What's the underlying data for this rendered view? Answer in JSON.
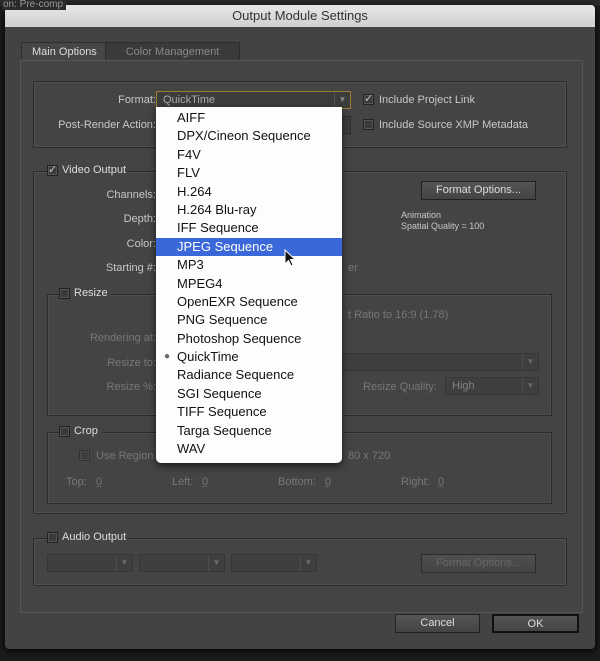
{
  "background": {
    "text": "on: Pre-comp"
  },
  "window": {
    "title": "Output Module Settings"
  },
  "tabs": [
    {
      "label": "Main Options",
      "active": true
    },
    {
      "label": "Color Management",
      "active": false
    }
  ],
  "format": {
    "label": "Format:",
    "value": "QuickTime"
  },
  "post_render": {
    "label": "Post-Render Action:"
  },
  "include_project_link": {
    "label": "Include Project Link",
    "checked": true
  },
  "include_xmp": {
    "label": "Include Source XMP Metadata",
    "checked": false
  },
  "video": {
    "label": "Video Output",
    "checked": true,
    "channels_label": "Channels:",
    "depth_label": "Depth:",
    "color_label": "Color:",
    "starting_label": "Starting #:",
    "format_options": "Format Options...",
    "codec": "Animation",
    "quality": "Spatial Quality = 100",
    "starting_hint": "er"
  },
  "resize": {
    "label": "Resize",
    "checked": false,
    "aspect": "t Ratio to 16:9 (1.78)",
    "rendering_at": "Rendering at:",
    "resize_to": "Resize to:",
    "resize_pct": "Resize %:",
    "quality_label": "Resize Quality:",
    "quality_value": "High"
  },
  "crop": {
    "label": "Crop",
    "checked": false,
    "use_region": "Use Region o",
    "final_size": "80 x 720",
    "top_label": "Top:",
    "top": "0",
    "left_label": "Left:",
    "left": "0",
    "bottom_label": "Bottom:",
    "bottom": "0",
    "right_label": "Right:",
    "right": "0"
  },
  "audio": {
    "label": "Audio Output",
    "checked": false,
    "format_options": "Format Options..."
  },
  "buttons": {
    "cancel": "Cancel",
    "ok": "OK"
  },
  "format_menu": {
    "items": [
      "AIFF",
      "DPX/Cineon Sequence",
      "F4V",
      "FLV",
      "H.264",
      "H.264 Blu-ray",
      "IFF Sequence",
      "JPEG Sequence",
      "MP3",
      "MPEG4",
      "OpenEXR Sequence",
      "PNG Sequence",
      "Photoshop Sequence",
      "QuickTime",
      "Radiance Sequence",
      "SGI Sequence",
      "TIFF Sequence",
      "Targa Sequence",
      "WAV"
    ],
    "highlighted": "JPEG Sequence",
    "selected": "QuickTime",
    "highlight_color": "#3b68d8"
  }
}
